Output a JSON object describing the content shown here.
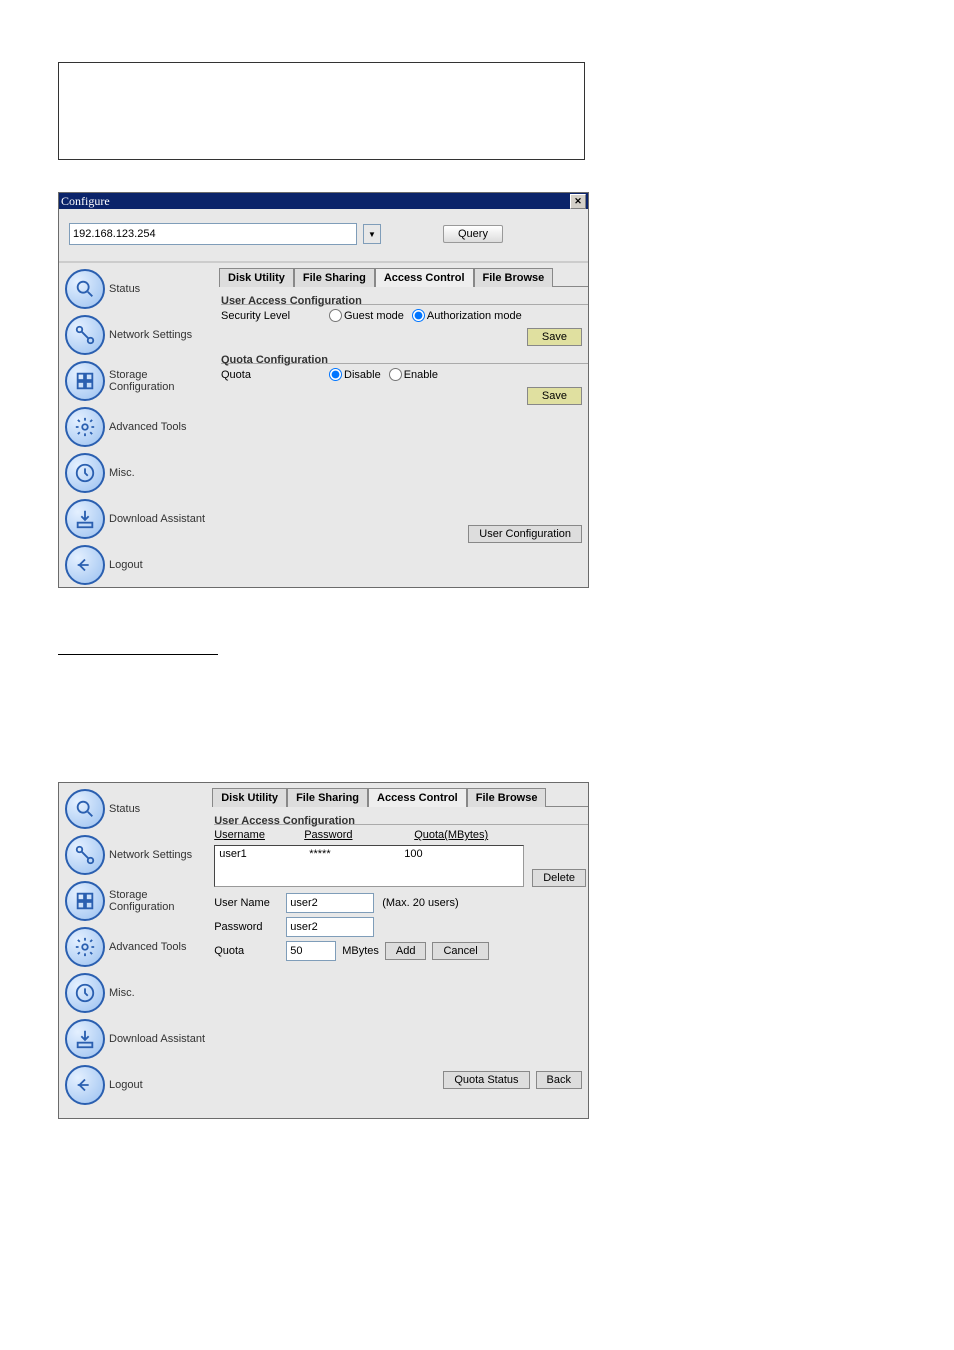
{
  "window": {
    "title": "Configure",
    "close": "✕"
  },
  "query": {
    "ip": "192.168.123.254",
    "button": "Query"
  },
  "nav": {
    "status": "Status",
    "network": "Network Settings",
    "storage": "Storage Configuration",
    "advanced": "Advanced Tools",
    "misc": "Misc.",
    "download": "Download Assistant",
    "logout": "Logout"
  },
  "tabs": {
    "disk": "Disk Utility",
    "share": "File Sharing",
    "access": "Access Control",
    "browse": "File Browse"
  },
  "panel1": {
    "group1": "User Access Configuration",
    "sec_label": "Security Level",
    "guest": "Guest mode",
    "auth": "Authorization mode",
    "save": "Save",
    "group2": "Quota Configuration",
    "quota_label": "Quota",
    "disable": "Disable",
    "enable": "Enable",
    "userconf": "User Configuration"
  },
  "panel2": {
    "group1": "User Access Configuration",
    "col_user": "Username",
    "col_pass": "Password",
    "col_quota": "Quota(MBytes)",
    "row_user": "user1",
    "row_pass": "*****",
    "row_quota": "100",
    "delete": "Delete",
    "uname_label": "User Name",
    "uname_val": "user2",
    "max": "(Max. 20 users)",
    "pass_label": "Password",
    "pass_val": "user2",
    "q_label": "Quota",
    "q_val": "50",
    "mbytes": "MBytes",
    "add": "Add",
    "cancel": "Cancel",
    "qstatus": "Quota Status",
    "back": "Back"
  }
}
